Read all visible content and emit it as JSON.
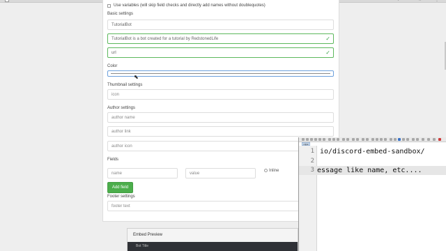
{
  "browser": {
    "top_icons": [
      "share-icon",
      "star-icon",
      "menu-icon"
    ]
  },
  "form": {
    "use_variables_label": "Use variables (will skip field checks and directly add names without doublequotes)",
    "basic_settings_label": "Basic settings",
    "title_value": "TutorialBot",
    "description_value": "TutorialBot is a bot created for a tutorial by RedstonedLife",
    "url_value": "url",
    "color_label": "Color",
    "thumbnail_label": "Thumbnail settings",
    "thumbnail_placeholder": "icon",
    "author_label": "Author settings",
    "author_name_placeholder": "author name",
    "author_link_placeholder": "author link",
    "author_icon_placeholder": "author icon",
    "fields_label": "Fields",
    "field_name_placeholder": "name",
    "field_value_placeholder": "value",
    "inline_label": "Inline",
    "add_field_button": "Add field",
    "footer_label": "Footer settings",
    "footer_placeholder": "footer text",
    "check_icon": "check-icon"
  },
  "preview": {
    "title": "Embed Preview",
    "content_text": "Bot Title"
  },
  "editor": {
    "tab_label": "new 1",
    "lines": [
      {
        "num": "1",
        "text": "io/discord-embed-sandbox/"
      },
      {
        "num": "2",
        "text": ""
      },
      {
        "num": "3",
        "text": "essage like name, etc...."
      }
    ]
  }
}
